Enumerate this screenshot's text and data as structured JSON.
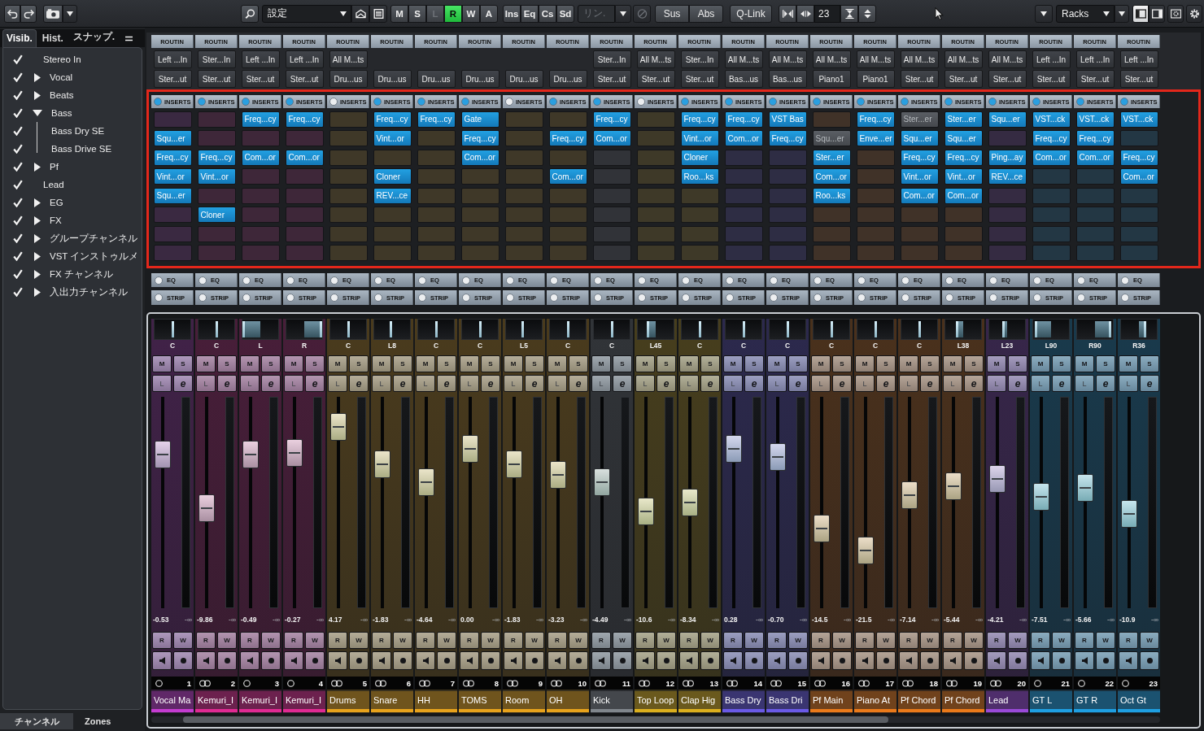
{
  "toolbar": {
    "preset": "設定",
    "modes": [
      {
        "label": "M",
        "on": false,
        "disabled": false
      },
      {
        "label": "S",
        "on": false,
        "disabled": false
      },
      {
        "label": "L",
        "on": false,
        "disabled": true
      },
      {
        "label": "R",
        "on": true,
        "disabled": false
      },
      {
        "label": "W",
        "on": false,
        "disabled": false
      },
      {
        "label": "A",
        "on": false,
        "disabled": false
      }
    ],
    "racks": [
      "Ins",
      "Eq",
      "Cs",
      "Sd"
    ],
    "link": {
      "label": "リン.",
      "disabled": true
    },
    "q_modes": [
      "Sus",
      "Abs"
    ],
    "qlink": "Q-Link",
    "channel_count": "23",
    "rack_menu": "Racks"
  },
  "sidebar": {
    "tabs": [
      {
        "label": "Visib.",
        "selected": true
      },
      {
        "label": "Hist.",
        "selected": false
      },
      {
        "label": "スナップ.",
        "selected": false
      }
    ],
    "tree": [
      {
        "kind": "channel",
        "label": "Stereo In",
        "checked": true
      },
      {
        "kind": "folder",
        "label": "Vocal",
        "checked": true,
        "expanded": false
      },
      {
        "kind": "folder",
        "label": "Beats",
        "checked": true,
        "expanded": false
      },
      {
        "kind": "folder",
        "label": "Bass",
        "checked": true,
        "expanded": true,
        "children": [
          {
            "kind": "channel",
            "label": "Bass Dry SE",
            "checked": true
          },
          {
            "kind": "channel",
            "label": "Bass Drive SE",
            "checked": true
          }
        ]
      },
      {
        "kind": "folder",
        "label": "Pf",
        "checked": true,
        "expanded": false
      },
      {
        "kind": "channel",
        "label": "Lead",
        "checked": true
      },
      {
        "kind": "folder",
        "label": "EG",
        "checked": true,
        "expanded": false
      },
      {
        "kind": "folder",
        "label": "FX",
        "checked": true,
        "expanded": false
      },
      {
        "kind": "folder",
        "label": "グループチャンネル",
        "checked": true,
        "expanded": false
      },
      {
        "kind": "folder",
        "label": "VST インストゥルメ",
        "checked": true,
        "expanded": false
      },
      {
        "kind": "folder",
        "label": "FX チャンネル",
        "checked": true,
        "expanded": false
      },
      {
        "kind": "folder",
        "label": "入出力チャンネル",
        "checked": true,
        "expanded": false
      }
    ],
    "bottom_tabs": [
      {
        "label": "チャンネル",
        "selected": true
      },
      {
        "label": "Zones",
        "selected": false
      }
    ]
  },
  "channels": [
    {
      "routing_label": "ROUTIN",
      "input": "Left ...In",
      "output": "Ster...ut",
      "inserts_label": "INSERTS",
      "inserts_on": true,
      "inserts": [
        {
          "kind": "empty"
        },
        {
          "kind": "plugin",
          "name": "Squ...er",
          "bypassed": false
        },
        {
          "kind": "plugin",
          "name": "Freq...cy",
          "bypassed": false
        },
        {
          "kind": "plugin",
          "name": "Vint...or",
          "bypassed": false
        },
        {
          "kind": "plugin",
          "name": "Squ...er",
          "bypassed": false
        }
      ],
      "eq_label": "EQ",
      "eq_on": false,
      "strip_label": "STRIP",
      "strip_on": false,
      "pan": {
        "label": "C",
        "level": 0.5
      },
      "ms": [
        "M",
        "S"
      ],
      "listen": {
        "label": "L",
        "disabled": true
      },
      "edit": "e",
      "fader": {
        "level": 0.76
      },
      "volume": "-0.53",
      "peak": "-∞",
      "rw": [
        "R",
        "W"
      ],
      "stereo": false,
      "number": "1",
      "name": "Vocal Ma",
      "color": "#c43cd0"
    },
    {
      "routing_label": "ROUTIN",
      "input": "Ster...In",
      "output": "Ster...ut",
      "inserts_label": "INSERTS",
      "inserts_on": true,
      "inserts": [
        {
          "kind": "empty"
        },
        {
          "kind": "empty"
        },
        {
          "kind": "plugin",
          "name": "Freq...cy",
          "bypassed": false
        },
        {
          "kind": "plugin",
          "name": "Vint...or",
          "bypassed": false
        },
        {
          "kind": "empty"
        },
        {
          "kind": "plugin",
          "name": "Cloner",
          "bypassed": false
        }
      ],
      "eq_label": "EQ",
      "eq_on": false,
      "strip_label": "STRIP",
      "strip_on": false,
      "pan": {
        "label": "C",
        "level": 0.5
      },
      "ms": [
        "M",
        "S"
      ],
      "listen": {
        "label": "L",
        "disabled": true
      },
      "edit": "e",
      "fader": {
        "level": 0.47
      },
      "volume": "-9.86",
      "peak": "-∞",
      "rw": [
        "R",
        "W"
      ],
      "stereo": true,
      "number": "2",
      "name": "Kemuri_I",
      "color": "#e02a92"
    },
    {
      "routing_label": "ROUTIN",
      "input": "Left ...In",
      "output": "Ster...ut",
      "inserts_label": "INSERTS",
      "inserts_on": true,
      "inserts": [
        {
          "kind": "plugin",
          "name": "Freq...cy",
          "bypassed": false
        },
        {
          "kind": "empty"
        },
        {
          "kind": "plugin",
          "name": "Com...or",
          "bypassed": false
        }
      ],
      "eq_label": "EQ",
      "eq_on": false,
      "strip_label": "STRIP",
      "strip_on": false,
      "pan": {
        "label": "L",
        "level": 0
      },
      "ms": [
        "M",
        "S"
      ],
      "listen": {
        "label": "L",
        "disabled": true
      },
      "edit": "e",
      "fader": {
        "level": 0.76
      },
      "volume": "-0.49",
      "peak": "-∞",
      "rw": [
        "R",
        "W"
      ],
      "stereo": false,
      "number": "3",
      "name": "Kemuri_I",
      "color": "#e02a92"
    },
    {
      "routing_label": "ROUTIN",
      "input": "Left ...In",
      "output": "Ster...ut",
      "inserts_label": "INSERTS",
      "inserts_on": true,
      "inserts": [
        {
          "kind": "plugin",
          "name": "Freq...cy",
          "bypassed": false
        },
        {
          "kind": "empty"
        },
        {
          "kind": "plugin",
          "name": "Com...or",
          "bypassed": false
        }
      ],
      "eq_label": "EQ",
      "eq_on": false,
      "strip_label": "STRIP",
      "strip_on": false,
      "pan": {
        "label": "R",
        "level": 1
      },
      "ms": [
        "M",
        "S"
      ],
      "listen": {
        "label": "L",
        "disabled": true
      },
      "edit": "e",
      "fader": {
        "level": 0.77
      },
      "volume": "-0.27",
      "peak": "-∞",
      "rw": [
        "R",
        "W"
      ],
      "stereo": false,
      "number": "4",
      "name": "Kemuri_I",
      "color": "#e02a92"
    },
    {
      "routing_label": "ROUTIN",
      "input": "All M...ts",
      "output": "Dru...us",
      "inserts_label": "INSERTS",
      "inserts_on": false,
      "eq_label": "EQ",
      "eq_on": false,
      "strip_label": "STRIP",
      "strip_on": false,
      "pan": {
        "label": "C",
        "level": 0.5
      },
      "ms": [
        "M",
        "S"
      ],
      "listen": {
        "label": "L",
        "disabled": true
      },
      "edit": "e",
      "fader": {
        "level": 0.91
      },
      "volume": "4.17",
      "peak": "-∞",
      "rw": [
        "R",
        "W"
      ],
      "stereo": true,
      "number": "5",
      "name": "Drums",
      "color": "#e8a31c"
    },
    {
      "routing_label": "ROUTIN",
      "output": "Dru...us",
      "inserts_label": "INSERTS",
      "inserts_on": true,
      "inserts": [
        {
          "kind": "plugin",
          "name": "Freq...cy",
          "bypassed": false
        },
        {
          "kind": "plugin",
          "name": "Vint...or",
          "bypassed": false
        },
        {
          "kind": "empty"
        },
        {
          "kind": "plugin",
          "name": "Cloner",
          "bypassed": false
        },
        {
          "kind": "plugin",
          "name": "REV...ce",
          "bypassed": false
        }
      ],
      "eq_label": "EQ",
      "eq_on": false,
      "strip_label": "STRIP",
      "strip_on": false,
      "pan": {
        "label": "L8",
        "level": 0.46
      },
      "ms": [
        "M",
        "S"
      ],
      "listen": {
        "label": "L",
        "disabled": true
      },
      "edit": "e",
      "fader": {
        "level": 0.71
      },
      "volume": "-1.83",
      "peak": "-∞",
      "rw": [
        "R",
        "W"
      ],
      "stereo": true,
      "number": "6",
      "name": "Snare",
      "color": "#e8a31c"
    },
    {
      "routing_label": "ROUTIN",
      "output": "Dru...us",
      "inserts_label": "INSERTS",
      "inserts_on": true,
      "inserts": [
        {
          "kind": "plugin",
          "name": "Freq...cy",
          "bypassed": false
        }
      ],
      "eq_label": "EQ",
      "eq_on": false,
      "strip_label": "STRIP",
      "strip_on": false,
      "pan": {
        "label": "C",
        "level": 0.5
      },
      "ms": [
        "M",
        "S"
      ],
      "listen": {
        "label": "L",
        "disabled": true
      },
      "edit": "e",
      "fader": {
        "level": 0.61
      },
      "volume": "-4.64",
      "peak": "-∞",
      "rw": [
        "R",
        "W"
      ],
      "stereo": true,
      "number": "7",
      "name": "HH",
      "color": "#e8a31c"
    },
    {
      "routing_label": "ROUTIN",
      "output": "Dru...us",
      "inserts_label": "INSERTS",
      "inserts_on": true,
      "inserts": [
        {
          "kind": "plugin",
          "name": "Gate",
          "bypassed": false
        },
        {
          "kind": "plugin",
          "name": "Freq...cy",
          "bypassed": false
        },
        {
          "kind": "plugin",
          "name": "Com...or",
          "bypassed": false
        }
      ],
      "eq_label": "EQ",
      "eq_on": false,
      "strip_label": "STRIP",
      "strip_on": false,
      "pan": {
        "label": "C",
        "level": 0.5
      },
      "ms": [
        "M",
        "S"
      ],
      "listen": {
        "label": "L",
        "disabled": true
      },
      "edit": "e",
      "fader": {
        "level": 0.79
      },
      "volume": "0.00",
      "peak": "-∞",
      "rw": [
        "R",
        "W"
      ],
      "stereo": true,
      "number": "8",
      "name": "TOMS",
      "color": "#e8a31c"
    },
    {
      "routing_label": "ROUTIN",
      "output": "Dru...us",
      "inserts_label": "INSERTS",
      "inserts_on": false,
      "eq_label": "EQ",
      "eq_on": false,
      "strip_label": "STRIP",
      "strip_on": false,
      "pan": {
        "label": "L5",
        "level": 0.475
      },
      "ms": [
        "M",
        "S"
      ],
      "listen": {
        "label": "L",
        "disabled": true
      },
      "edit": "e",
      "fader": {
        "level": 0.71
      },
      "volume": "-1.83",
      "peak": "-∞",
      "rw": [
        "R",
        "W"
      ],
      "stereo": true,
      "number": "9",
      "name": "Room",
      "color": "#e8a31c"
    },
    {
      "routing_label": "ROUTIN",
      "output": "Dru...us",
      "inserts_label": "INSERTS",
      "inserts_on": true,
      "inserts": [
        {
          "kind": "empty"
        },
        {
          "kind": "plugin",
          "name": "Freq...cy",
          "bypassed": false
        },
        {
          "kind": "empty"
        },
        {
          "kind": "plugin",
          "name": "Com...or",
          "bypassed": false
        }
      ],
      "eq_label": "EQ",
      "eq_on": false,
      "strip_label": "STRIP",
      "strip_on": false,
      "pan": {
        "label": "C",
        "level": 0.5
      },
      "ms": [
        "M",
        "S"
      ],
      "listen": {
        "label": "L",
        "disabled": true
      },
      "edit": "e",
      "fader": {
        "level": 0.65
      },
      "volume": "-3.23",
      "peak": "-∞",
      "rw": [
        "R",
        "W"
      ],
      "stereo": true,
      "number": "10",
      "name": "OH",
      "color": "#e8a31c"
    },
    {
      "routing_label": "ROUTIN",
      "input": "Ster...In",
      "output": "Ster...ut",
      "inserts_label": "INSERTS",
      "inserts_on": true,
      "inserts": [
        {
          "kind": "plugin",
          "name": "Freq...cy",
          "bypassed": false
        },
        {
          "kind": "plugin",
          "name": "Com...or",
          "bypassed": false
        }
      ],
      "eq_label": "EQ",
      "eq_on": false,
      "strip_label": "STRIP",
      "strip_on": false,
      "pan": {
        "label": "C",
        "level": 0.5
      },
      "ms": [
        "M",
        "S"
      ],
      "listen": {
        "label": "L",
        "disabled": true
      },
      "edit": "e",
      "fader": {
        "level": 0.61
      },
      "volume": "-4.49",
      "peak": "-∞",
      "rw": [
        "R",
        "W"
      ],
      "stereo": true,
      "number": "11",
      "name": "Kick",
      "color": "#80868c"
    },
    {
      "routing_label": "ROUTIN",
      "input": "All M...ts",
      "output": "Ster...ut",
      "inserts_label": "INSERTS",
      "inserts_on": false,
      "eq_label": "EQ",
      "eq_on": false,
      "strip_label": "STRIP",
      "strip_on": false,
      "pan": {
        "label": "L45",
        "level": 0.275
      },
      "ms": [
        "M",
        "S"
      ],
      "listen": {
        "label": "L",
        "disabled": true
      },
      "edit": "e",
      "fader": {
        "level": 0.45
      },
      "volume": "-10.6",
      "peak": "-∞",
      "rw": [
        "R",
        "W"
      ],
      "stereo": true,
      "number": "12",
      "name": "Top Loop",
      "color": "#dcb01e"
    },
    {
      "routing_label": "ROUTIN",
      "input": "Ster...In",
      "output": "Ster...ut",
      "inserts_label": "INSERTS",
      "inserts_on": true,
      "inserts": [
        {
          "kind": "plugin",
          "name": "Freq...cy",
          "bypassed": false
        },
        {
          "kind": "plugin",
          "name": "Vint...or",
          "bypassed": false
        },
        {
          "kind": "plugin",
          "name": "Cloner",
          "bypassed": false
        },
        {
          "kind": "plugin",
          "name": "Roo...ks",
          "bypassed": false
        }
      ],
      "eq_label": "EQ",
      "eq_on": false,
      "strip_label": "STRIP",
      "strip_on": false,
      "pan": {
        "label": "C",
        "level": 0.5
      },
      "ms": [
        "M",
        "S"
      ],
      "listen": {
        "label": "L",
        "disabled": true
      },
      "edit": "e",
      "fader": {
        "level": 0.5
      },
      "volume": "-8.34",
      "peak": "-∞",
      "rw": [
        "R",
        "W"
      ],
      "stereo": true,
      "number": "13",
      "name": "Clap Hig",
      "color": "#dcb01e"
    },
    {
      "routing_label": "ROUTIN",
      "input": "All M...ts",
      "output": "Bas...us",
      "inserts_label": "INSERTS",
      "inserts_on": true,
      "inserts": [
        {
          "kind": "plugin",
          "name": "Freq...cy",
          "bypassed": false
        },
        {
          "kind": "plugin",
          "name": "Com...or",
          "bypassed": false
        }
      ],
      "eq_label": "EQ",
      "eq_on": false,
      "strip_label": "STRIP",
      "strip_on": false,
      "pan": {
        "label": "C",
        "level": 0.5
      },
      "ms": [
        "M",
        "S"
      ],
      "listen": {
        "label": "L",
        "disabled": true
      },
      "edit": "e",
      "fader": {
        "level": 0.79
      },
      "volume": "0.28",
      "peak": "-∞",
      "rw": [
        "R",
        "W"
      ],
      "stereo": true,
      "number": "14",
      "name": "Bass Dry",
      "color": "#6a5ae6"
    },
    {
      "routing_label": "ROUTIN",
      "input": "All M...ts",
      "output": "Bas...us",
      "inserts_label": "INSERTS",
      "inserts_on": true,
      "inserts": [
        {
          "kind": "plugin",
          "name": "VST Bas",
          "bypassed": false
        },
        {
          "kind": "plugin",
          "name": "Freq...cy",
          "bypassed": false
        }
      ],
      "eq_label": "EQ",
      "eq_on": false,
      "strip_label": "STRIP",
      "strip_on": false,
      "pan": {
        "label": "C",
        "level": 0.5
      },
      "ms": [
        "M",
        "S"
      ],
      "listen": {
        "label": "L",
        "disabled": true
      },
      "edit": "e",
      "fader": {
        "level": 0.75
      },
      "volume": "-0.70",
      "peak": "-∞",
      "rw": [
        "R",
        "W"
      ],
      "stereo": true,
      "number": "15",
      "name": "Bass Dri",
      "color": "#6a5ae6"
    },
    {
      "routing_label": "ROUTIN",
      "input": "All M...ts",
      "output": "Piano1",
      "inserts_label": "INSERTS",
      "inserts_on": true,
      "inserts": [
        {
          "kind": "empty"
        },
        {
          "kind": "plugin",
          "name": "Squ...er",
          "bypassed": true
        },
        {
          "kind": "plugin",
          "name": "Ster...er",
          "bypassed": false
        },
        {
          "kind": "plugin",
          "name": "Com...or",
          "bypassed": false
        },
        {
          "kind": "plugin",
          "name": "Roo...ks",
          "bypassed": false
        }
      ],
      "eq_label": "EQ",
      "eq_on": false,
      "strip_label": "STRIP",
      "strip_on": false,
      "pan": {
        "label": "C",
        "level": 0.5
      },
      "ms": [
        "M",
        "S"
      ],
      "listen": {
        "label": "L",
        "disabled": true
      },
      "edit": "e",
      "fader": {
        "level": 0.36
      },
      "volume": "-14.5",
      "peak": "-∞",
      "rw": [
        "R",
        "W"
      ],
      "stereo": true,
      "number": "16",
      "name": "Pf Main",
      "color": "#ea7a1a"
    },
    {
      "routing_label": "ROUTIN",
      "input": "All M...ts",
      "output": "Piano1",
      "inserts_label": "INSERTS",
      "inserts_on": true,
      "inserts": [
        {
          "kind": "plugin",
          "name": "Freq...cy",
          "bypassed": false
        },
        {
          "kind": "plugin",
          "name": "Enve...er",
          "bypassed": false
        }
      ],
      "eq_label": "EQ",
      "eq_on": false,
      "strip_label": "STRIP",
      "strip_on": false,
      "pan": {
        "label": "C",
        "level": 0.5
      },
      "ms": [
        "M",
        "S"
      ],
      "listen": {
        "label": "L",
        "disabled": true
      },
      "edit": "e",
      "fader": {
        "level": 0.24
      },
      "volume": "-21.5",
      "peak": "-∞",
      "rw": [
        "R",
        "W"
      ],
      "stereo": true,
      "number": "17",
      "name": "Piano At",
      "color": "#ea7a1a"
    },
    {
      "routing_label": "ROUTIN",
      "input": "All M...ts",
      "output": "Ster...ut",
      "inserts_label": "INSERTS",
      "inserts_on": true,
      "inserts": [
        {
          "kind": "plugin",
          "name": "Ster...er",
          "bypassed": true
        },
        {
          "kind": "plugin",
          "name": "Squ...er",
          "bypassed": false
        },
        {
          "kind": "plugin",
          "name": "Freq...cy",
          "bypassed": false
        },
        {
          "kind": "plugin",
          "name": "Vint...or",
          "bypassed": false
        },
        {
          "kind": "plugin",
          "name": "Com...or",
          "bypassed": false
        }
      ],
      "eq_label": "EQ",
      "eq_on": false,
      "strip_label": "STRIP",
      "strip_on": false,
      "pan": {
        "label": "C",
        "level": 0.5
      },
      "ms": [
        "M",
        "S"
      ],
      "listen": {
        "label": "L",
        "disabled": true
      },
      "edit": "e",
      "fader": {
        "level": 0.54
      },
      "volume": "-7.14",
      "peak": "-∞",
      "rw": [
        "R",
        "W"
      ],
      "stereo": true,
      "number": "18",
      "name": "Pf Chord",
      "color": "#ea7a1a"
    },
    {
      "routing_label": "ROUTIN",
      "input": "All M...ts",
      "output": "Ster...ut",
      "inserts_label": "INSERTS",
      "inserts_on": true,
      "inserts": [
        {
          "kind": "plugin",
          "name": "Ster...er",
          "bypassed": false
        },
        {
          "kind": "plugin",
          "name": "Squ...er",
          "bypassed": false
        },
        {
          "kind": "plugin",
          "name": "Freq...cy",
          "bypassed": false
        },
        {
          "kind": "plugin",
          "name": "Vint...or",
          "bypassed": false
        },
        {
          "kind": "plugin",
          "name": "Com...or",
          "bypassed": false
        }
      ],
      "eq_label": "EQ",
      "eq_on": false,
      "strip_label": "STRIP",
      "strip_on": false,
      "pan": {
        "label": "L38",
        "level": 0.31
      },
      "ms": [
        "M",
        "S"
      ],
      "listen": {
        "label": "L",
        "disabled": true
      },
      "edit": "e",
      "fader": {
        "level": 0.59
      },
      "volume": "-5.44",
      "peak": "-∞",
      "rw": [
        "R",
        "W"
      ],
      "stereo": true,
      "number": "19",
      "name": "Pf Chord",
      "color": "#ea7a1a"
    },
    {
      "routing_label": "ROUTIN",
      "input": "All M...ts",
      "output": "Ster...ut",
      "inserts_label": "INSERTS",
      "inserts_on": true,
      "inserts": [
        {
          "kind": "plugin",
          "name": "Squ...er",
          "bypassed": false
        },
        {
          "kind": "empty"
        },
        {
          "kind": "plugin",
          "name": "Ping...ay",
          "bypassed": false
        },
        {
          "kind": "plugin",
          "name": "REV...ce",
          "bypassed": false
        }
      ],
      "eq_label": "EQ",
      "eq_on": false,
      "strip_label": "STRIP",
      "strip_on": false,
      "pan": {
        "label": "L23",
        "level": 0.385
      },
      "ms": [
        "M",
        "S"
      ],
      "listen": {
        "label": "L",
        "disabled": true
      },
      "edit": "e",
      "fader": {
        "level": 0.63
      },
      "volume": "-4.21",
      "peak": "-∞",
      "rw": [
        "R",
        "W"
      ],
      "stereo": true,
      "number": "20",
      "name": "Lead",
      "color": "#9a4ad8"
    },
    {
      "routing_label": "ROUTIN",
      "input": "Left ...In",
      "output": "Ster...ut",
      "inserts_label": "INSERTS",
      "inserts_on": true,
      "inserts": [
        {
          "kind": "plugin",
          "name": "VST...ck",
          "bypassed": false
        },
        {
          "kind": "plugin",
          "name": "Freq...cy",
          "bypassed": false
        },
        {
          "kind": "plugin",
          "name": "Com...or",
          "bypassed": false
        }
      ],
      "eq_label": "EQ",
      "eq_on": false,
      "strip_label": "STRIP",
      "strip_on": false,
      "pan": {
        "label": "L90",
        "level": 0.05
      },
      "ms": [
        "M",
        "S"
      ],
      "listen": {
        "label": "L",
        "disabled": true
      },
      "edit": "e",
      "fader": {
        "level": 0.53
      },
      "volume": "-7.51",
      "peak": "-∞",
      "rw": [
        "R",
        "W"
      ],
      "stereo": false,
      "number": "21",
      "name": "GT L",
      "color": "#1e9fe2"
    },
    {
      "routing_label": "ROUTIN",
      "input": "Left ...In",
      "output": "Ster...ut",
      "inserts_label": "INSERTS",
      "inserts_on": true,
      "inserts": [
        {
          "kind": "plugin",
          "name": "VST...ck",
          "bypassed": false
        },
        {
          "kind": "plugin",
          "name": "Freq...cy",
          "bypassed": false
        },
        {
          "kind": "plugin",
          "name": "Com...or",
          "bypassed": false
        }
      ],
      "eq_label": "EQ",
      "eq_on": false,
      "strip_label": "STRIP",
      "strip_on": false,
      "pan": {
        "label": "R90",
        "level": 0.95
      },
      "ms": [
        "M",
        "S"
      ],
      "listen": {
        "label": "L",
        "disabled": true
      },
      "edit": "e",
      "fader": {
        "level": 0.58
      },
      "volume": "-5.66",
      "peak": "-∞",
      "rw": [
        "R",
        "W"
      ],
      "stereo": false,
      "number": "22",
      "name": "GT R",
      "color": "#1e9fe2"
    },
    {
      "routing_label": "ROUTIN",
      "input": "Left ...In",
      "output": "Ster...ut",
      "inserts_label": "INSERTS",
      "inserts_on": true,
      "inserts": [
        {
          "kind": "plugin",
          "name": "VST...ck",
          "bypassed": false
        },
        {
          "kind": "empty"
        },
        {
          "kind": "plugin",
          "name": "Freq...cy",
          "bypassed": false
        },
        {
          "kind": "plugin",
          "name": "Com...or",
          "bypassed": false
        }
      ],
      "eq_label": "EQ",
      "eq_on": false,
      "strip_label": "STRIP",
      "strip_on": false,
      "pan": {
        "label": "R36",
        "level": 0.68
      },
      "ms": [
        "M",
        "S"
      ],
      "listen": {
        "label": "L",
        "disabled": true
      },
      "edit": "e",
      "fader": {
        "level": 0.44
      },
      "volume": "-10.9",
      "peak": "-∞",
      "rw": [
        "R",
        "W"
      ],
      "stereo": false,
      "number": "23",
      "name": "Oct Gt",
      "color": "#1e9fe2"
    }
  ]
}
